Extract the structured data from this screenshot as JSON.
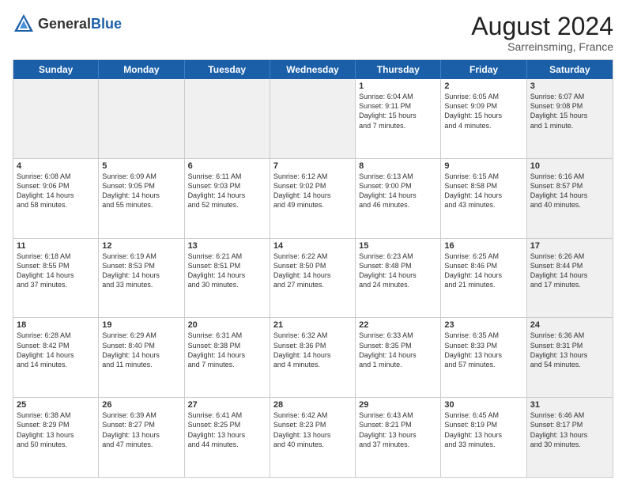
{
  "header": {
    "logo_general": "General",
    "logo_blue": "Blue",
    "month_year": "August 2024",
    "location": "Sarreinsming, France"
  },
  "weekdays": [
    "Sunday",
    "Monday",
    "Tuesday",
    "Wednesday",
    "Thursday",
    "Friday",
    "Saturday"
  ],
  "rows": [
    [
      {
        "day": "",
        "text": "",
        "shaded": true
      },
      {
        "day": "",
        "text": "",
        "shaded": true
      },
      {
        "day": "",
        "text": "",
        "shaded": true
      },
      {
        "day": "",
        "text": "",
        "shaded": true
      },
      {
        "day": "1",
        "text": "Sunrise: 6:04 AM\nSunset: 9:11 PM\nDaylight: 15 hours\nand 7 minutes.",
        "shaded": false
      },
      {
        "day": "2",
        "text": "Sunrise: 6:05 AM\nSunset: 9:09 PM\nDaylight: 15 hours\nand 4 minutes.",
        "shaded": false
      },
      {
        "day": "3",
        "text": "Sunrise: 6:07 AM\nSunset: 9:08 PM\nDaylight: 15 hours\nand 1 minute.",
        "shaded": true
      }
    ],
    [
      {
        "day": "4",
        "text": "Sunrise: 6:08 AM\nSunset: 9:06 PM\nDaylight: 14 hours\nand 58 minutes.",
        "shaded": false
      },
      {
        "day": "5",
        "text": "Sunrise: 6:09 AM\nSunset: 9:05 PM\nDaylight: 14 hours\nand 55 minutes.",
        "shaded": false
      },
      {
        "day": "6",
        "text": "Sunrise: 6:11 AM\nSunset: 9:03 PM\nDaylight: 14 hours\nand 52 minutes.",
        "shaded": false
      },
      {
        "day": "7",
        "text": "Sunrise: 6:12 AM\nSunset: 9:02 PM\nDaylight: 14 hours\nand 49 minutes.",
        "shaded": false
      },
      {
        "day": "8",
        "text": "Sunrise: 6:13 AM\nSunset: 9:00 PM\nDaylight: 14 hours\nand 46 minutes.",
        "shaded": false
      },
      {
        "day": "9",
        "text": "Sunrise: 6:15 AM\nSunset: 8:58 PM\nDaylight: 14 hours\nand 43 minutes.",
        "shaded": false
      },
      {
        "day": "10",
        "text": "Sunrise: 6:16 AM\nSunset: 8:57 PM\nDaylight: 14 hours\nand 40 minutes.",
        "shaded": true
      }
    ],
    [
      {
        "day": "11",
        "text": "Sunrise: 6:18 AM\nSunset: 8:55 PM\nDaylight: 14 hours\nand 37 minutes.",
        "shaded": false
      },
      {
        "day": "12",
        "text": "Sunrise: 6:19 AM\nSunset: 8:53 PM\nDaylight: 14 hours\nand 33 minutes.",
        "shaded": false
      },
      {
        "day": "13",
        "text": "Sunrise: 6:21 AM\nSunset: 8:51 PM\nDaylight: 14 hours\nand 30 minutes.",
        "shaded": false
      },
      {
        "day": "14",
        "text": "Sunrise: 6:22 AM\nSunset: 8:50 PM\nDaylight: 14 hours\nand 27 minutes.",
        "shaded": false
      },
      {
        "day": "15",
        "text": "Sunrise: 6:23 AM\nSunset: 8:48 PM\nDaylight: 14 hours\nand 24 minutes.",
        "shaded": false
      },
      {
        "day": "16",
        "text": "Sunrise: 6:25 AM\nSunset: 8:46 PM\nDaylight: 14 hours\nand 21 minutes.",
        "shaded": false
      },
      {
        "day": "17",
        "text": "Sunrise: 6:26 AM\nSunset: 8:44 PM\nDaylight: 14 hours\nand 17 minutes.",
        "shaded": true
      }
    ],
    [
      {
        "day": "18",
        "text": "Sunrise: 6:28 AM\nSunset: 8:42 PM\nDaylight: 14 hours\nand 14 minutes.",
        "shaded": false
      },
      {
        "day": "19",
        "text": "Sunrise: 6:29 AM\nSunset: 8:40 PM\nDaylight: 14 hours\nand 11 minutes.",
        "shaded": false
      },
      {
        "day": "20",
        "text": "Sunrise: 6:31 AM\nSunset: 8:38 PM\nDaylight: 14 hours\nand 7 minutes.",
        "shaded": false
      },
      {
        "day": "21",
        "text": "Sunrise: 6:32 AM\nSunset: 8:36 PM\nDaylight: 14 hours\nand 4 minutes.",
        "shaded": false
      },
      {
        "day": "22",
        "text": "Sunrise: 6:33 AM\nSunset: 8:35 PM\nDaylight: 14 hours\nand 1 minute.",
        "shaded": false
      },
      {
        "day": "23",
        "text": "Sunrise: 6:35 AM\nSunset: 8:33 PM\nDaylight: 13 hours\nand 57 minutes.",
        "shaded": false
      },
      {
        "day": "24",
        "text": "Sunrise: 6:36 AM\nSunset: 8:31 PM\nDaylight: 13 hours\nand 54 minutes.",
        "shaded": true
      }
    ],
    [
      {
        "day": "25",
        "text": "Sunrise: 6:38 AM\nSunset: 8:29 PM\nDaylight: 13 hours\nand 50 minutes.",
        "shaded": false
      },
      {
        "day": "26",
        "text": "Sunrise: 6:39 AM\nSunset: 8:27 PM\nDaylight: 13 hours\nand 47 minutes.",
        "shaded": false
      },
      {
        "day": "27",
        "text": "Sunrise: 6:41 AM\nSunset: 8:25 PM\nDaylight: 13 hours\nand 44 minutes.",
        "shaded": false
      },
      {
        "day": "28",
        "text": "Sunrise: 6:42 AM\nSunset: 8:23 PM\nDaylight: 13 hours\nand 40 minutes.",
        "shaded": false
      },
      {
        "day": "29",
        "text": "Sunrise: 6:43 AM\nSunset: 8:21 PM\nDaylight: 13 hours\nand 37 minutes.",
        "shaded": false
      },
      {
        "day": "30",
        "text": "Sunrise: 6:45 AM\nSunset: 8:19 PM\nDaylight: 13 hours\nand 33 minutes.",
        "shaded": false
      },
      {
        "day": "31",
        "text": "Sunrise: 6:46 AM\nSunset: 8:17 PM\nDaylight: 13 hours\nand 30 minutes.",
        "shaded": true
      }
    ]
  ]
}
